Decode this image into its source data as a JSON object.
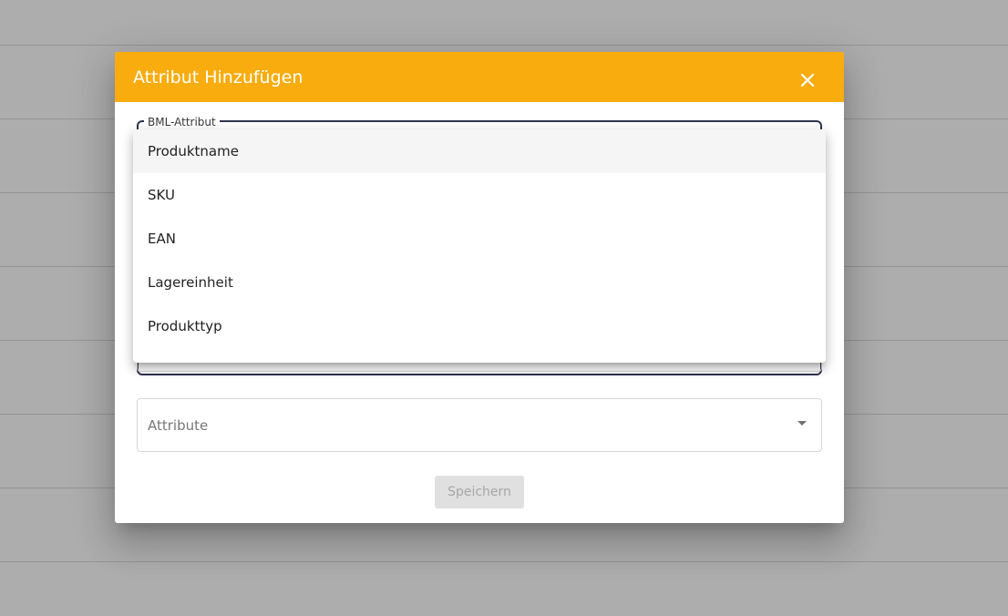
{
  "dialog": {
    "title": "Attribut Hinzufügen",
    "close_icon": "close-icon",
    "header_color": "#f8ac0d"
  },
  "bml_field": {
    "label": "BML-Attribut"
  },
  "dropdown": {
    "options": [
      {
        "label": "Produktname",
        "highlighted": true
      },
      {
        "label": "SKU",
        "highlighted": false
      },
      {
        "label": "EAN",
        "highlighted": false
      },
      {
        "label": "Lagereinheit",
        "highlighted": false
      },
      {
        "label": "Produkttyp",
        "highlighted": false
      }
    ]
  },
  "attribute_field": {
    "placeholder": "Attribute",
    "arrow_icon": "dropdown-arrow-icon"
  },
  "actions": {
    "save_label": "Speichern"
  }
}
